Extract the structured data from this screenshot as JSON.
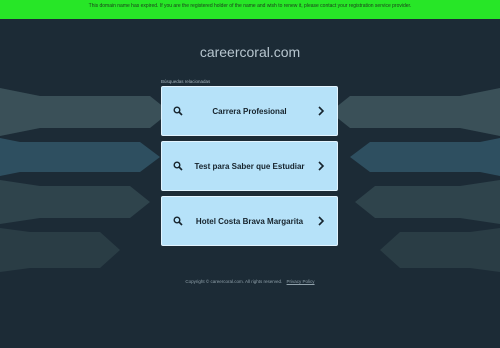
{
  "banner": {
    "text": "This domain name has expired. If you are the registered holder of the name and wish to renew it, please contact your registration service provider."
  },
  "site": {
    "domain": "careercoral.com"
  },
  "related": {
    "label": "Búsquedas relacionadas",
    "items": [
      {
        "label": "Carrera Profesional"
      },
      {
        "label": "Test para Saber que Estudiar"
      },
      {
        "label": "Hotel Costa Brava Margarita"
      }
    ]
  },
  "footer": {
    "copyright": "Copyright © careercoral.com.  All rights reserved.",
    "privacy_link": "Privacy Policy"
  },
  "colors": {
    "background": "#1c2b36",
    "banner": "#27e627",
    "card": "#b6e2f9",
    "card_text": "#16232c"
  },
  "icons": {
    "card_left": "search-icon",
    "card_right": "chevron-right-icon"
  }
}
